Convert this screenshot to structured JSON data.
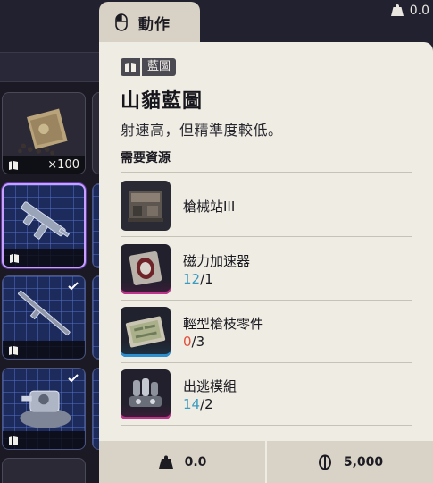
{
  "top_bar": {
    "weight": "0.0"
  },
  "inventory": {
    "slots": [
      {
        "count": "×100"
      }
    ]
  },
  "popup": {
    "tab_label": "動作",
    "badge_label": "藍圖",
    "title": "山貓藍圖",
    "description": "射速高，但精準度較低。",
    "requirements_heading": "需要資源",
    "resources": [
      {
        "name": "槍械站III",
        "have": "",
        "sep": "",
        "need": "",
        "rarity": "gray",
        "icon": "gun-bench-icon"
      },
      {
        "name": "磁力加速器",
        "have": "12",
        "sep": "/",
        "need": "1",
        "status": "ok",
        "rarity": "pink",
        "icon": "magnetic-accelerator-icon"
      },
      {
        "name": "輕型槍枝零件",
        "have": "0",
        "sep": "/",
        "need": "3",
        "status": "missing",
        "rarity": "blue",
        "icon": "light-gun-parts-icon"
      },
      {
        "name": "出逃模組",
        "have": "14",
        "sep": "/",
        "need": "2",
        "status": "ok",
        "rarity": "pink",
        "icon": "escape-module-icon"
      }
    ],
    "footer": {
      "weight": "0.0",
      "price": "5,000"
    }
  },
  "colors": {
    "panel_bg": "#efece4",
    "footer_bg": "#d8d2c7",
    "qty_ok": "#3b9bc0",
    "qty_missing": "#e2503c",
    "selected_outline": "#c9a0ff"
  }
}
